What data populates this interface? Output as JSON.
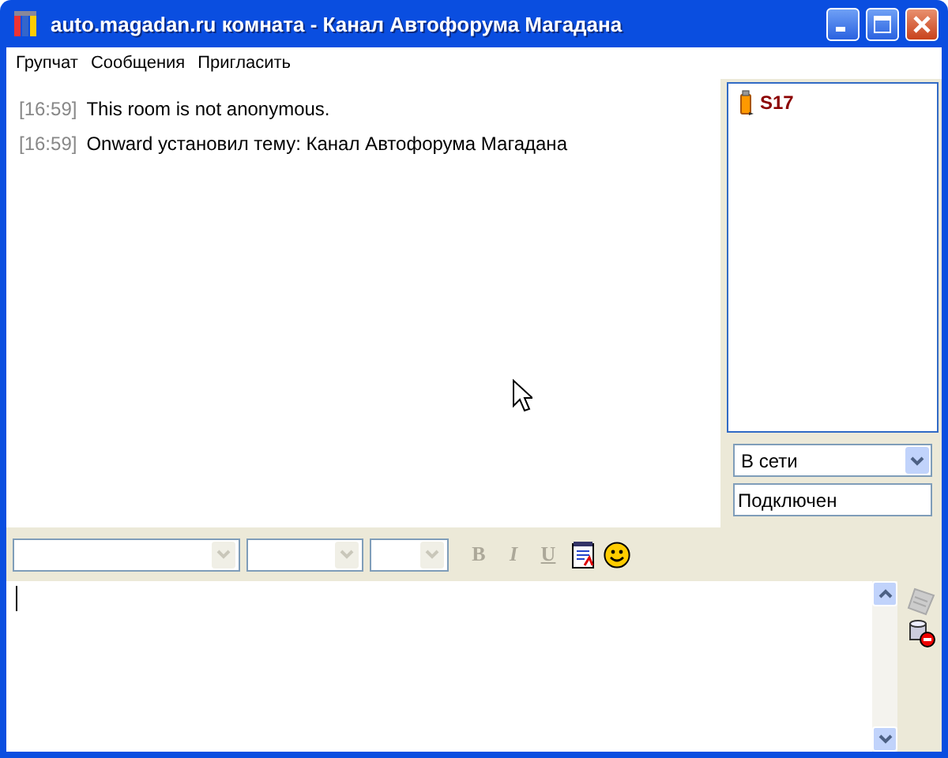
{
  "window": {
    "title": "auto.magadan.ru комната - Канал Автофорума Магадана"
  },
  "menu": [
    "Групчат",
    "Сообщения",
    "Пригласить"
  ],
  "messages": [
    {
      "time": "[16:59]",
      "text": "This room is not anonymous."
    },
    {
      "time": "[16:59]",
      "text": "Onward установил тему: Канал Автофорума Магадана"
    }
  ],
  "roster": [
    {
      "name": "S17"
    }
  ],
  "presence": {
    "value": "В сети"
  },
  "status_message": {
    "value": "Подключен"
  },
  "format_toolbar": {
    "selects": [
      {
        "kind": "font",
        "disabled": true
      },
      {
        "kind": "size",
        "disabled": true
      },
      {
        "kind": "color",
        "disabled": true
      }
    ],
    "buttons": [
      {
        "kind": "bold",
        "label": "B",
        "disabled": true
      },
      {
        "kind": "italic",
        "label": "I",
        "disabled": true
      },
      {
        "kind": "underline",
        "label": "U",
        "disabled": true
      },
      {
        "kind": "notepad",
        "disabled": false
      },
      {
        "kind": "smiley",
        "disabled": false
      }
    ]
  },
  "side_buttons": [
    {
      "kind": "notes",
      "disabled": true
    },
    {
      "kind": "block",
      "disabled": false
    }
  ]
}
